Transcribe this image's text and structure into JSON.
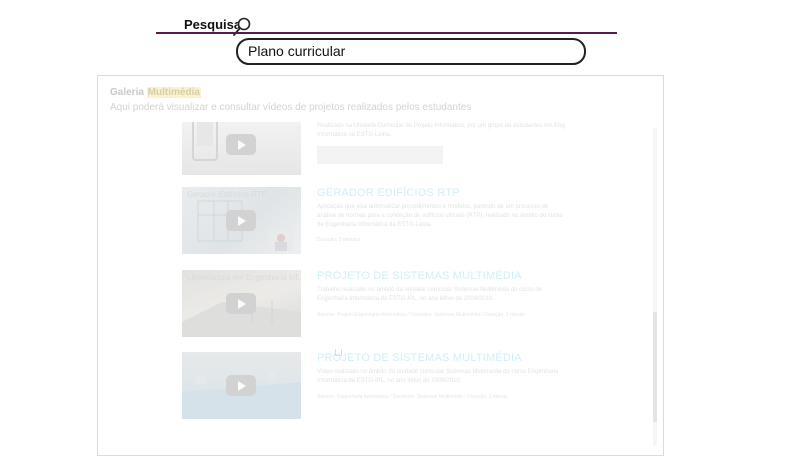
{
  "search": {
    "label": "Pesquisa",
    "value": "Plano curricular"
  },
  "gallery": {
    "title_prefix": "Galeria ",
    "title_highlight": "Multimédia",
    "subtitle": "Aqui poderá visualizar e consultar vídeos de projetos realizados pelos estudantes",
    "items": [
      {
        "title": "",
        "caption": "",
        "description": "Realizado na Unidade Curricular de Projeto Informático, por um grupo de estudantes em Eng. Informática na ESTG-Leiria."
      },
      {
        "title": "GERADOR EDIFÍCIOS RTP",
        "caption": "Gerador Edifícios RTP",
        "description": "Aplicação que visa automatizar procedimentos e modelos, partindo de um processo de análise de normas para a conceção de edifícios virtuais (RTP), realizado no âmbito do curso de Engenharia Informática da ESTG-Leiria.",
        "meta": "Duração: 3 minutos"
      },
      {
        "title": "PROJETO DE SISTEMAS MULTIMÉDIA",
        "caption": "Licenciatura em Engenharia Inf...",
        "description": "Trabalho realizado no âmbito da unidade curricular Sistemas Multimédia do curso de Engenharia Informática da ESTG-IPL, no ano letivo de 2009/2010.",
        "meta": "Autores: Projeto Engenharia Informática / Docentes: Sistemas Multimédia / Duração: 1 minuto"
      },
      {
        "title": "PROJETO DE SISTEMAS MULTIMÉDIA",
        "caption": "",
        "description": "Vídeo realizado no âmbito da unidade curricular Sistemas Multimédia do curso Engenharia Informática da ESTG-IPL, no ano letivo de 2009/2010.",
        "meta": "Autores: Engenharia Informática / Docentes: Sistemas Multimédia / Duração: 1 minuto"
      }
    ]
  }
}
